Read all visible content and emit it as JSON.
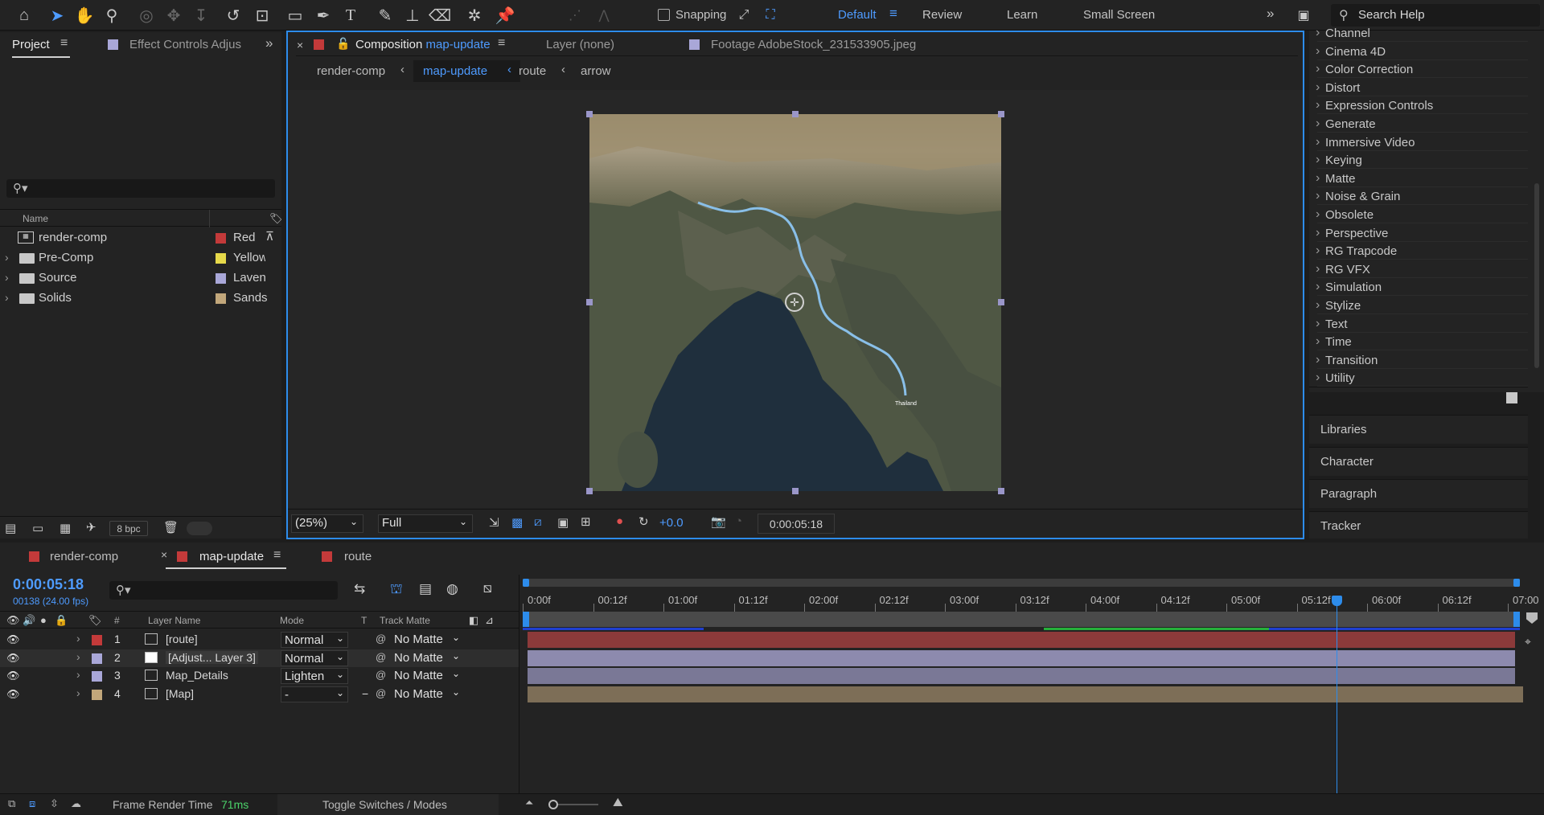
{
  "toolbar": {
    "snapping_label": "Snapping",
    "workspaces": [
      "Default",
      "Review",
      "Learn",
      "Small Screen"
    ],
    "active_workspace": "Default",
    "search_placeholder": "Search Help",
    "icons": [
      "home-icon",
      "selection-tool-icon",
      "hand-tool-icon",
      "zoom-tool-icon",
      "orbit-camera-icon",
      "pan-camera-icon",
      "dolly-camera-icon",
      "rotation-tool-icon",
      "pan-behind-icon",
      "rectangle-tool-icon",
      "pen-tool-icon",
      "type-tool-icon",
      "brush-tool-icon",
      "clone-stamp-icon",
      "eraser-tool-icon",
      "roto-brush-icon",
      "puppet-pin-icon"
    ]
  },
  "project_panel": {
    "tab_project": "Project",
    "tab_effect_controls": "Effect Controls Adjus",
    "column_name": "Name",
    "items": [
      {
        "name": "render-comp",
        "label": "Red",
        "label_color": "#c33a3a",
        "type": "composition"
      },
      {
        "name": "Pre-Comp",
        "label": "Yellow",
        "label_color": "#e6d94a",
        "type": "folder"
      },
      {
        "name": "Source",
        "label": "Laven",
        "label_color": "#a9a7d8",
        "type": "folder"
      },
      {
        "name": "Solids",
        "label": "Sands",
        "label_color": "#c2a77b",
        "type": "folder"
      }
    ],
    "bpc": "8 bpc"
  },
  "composition_panel": {
    "tab_prefix": "Composition",
    "tab_comp_name": "map-update",
    "tab_layer": "Layer (none)",
    "tab_footage": "Footage AdobeStock_231533905.jpeg",
    "breadcrumbs": [
      "render-comp",
      "map-update",
      "route",
      "arrow"
    ],
    "active_breadcrumb": "map-update",
    "zoom": "(25%)",
    "resolution": "Full",
    "exposure": "+0.0",
    "timecode": "0:00:05:18",
    "map_label": "Thailand"
  },
  "effects_panel": {
    "categories": [
      "Channel",
      "Cinema 4D",
      "Color Correction",
      "Distort",
      "Expression Controls",
      "Generate",
      "Immersive Video",
      "Keying",
      "Matte",
      "Noise & Grain",
      "Obsolete",
      "Perspective",
      "RG Trapcode",
      "RG VFX",
      "Simulation",
      "Stylize",
      "Text",
      "Time",
      "Transition",
      "Utility"
    ],
    "stacked_panels": [
      "Libraries",
      "Character",
      "Paragraph",
      "Tracker"
    ]
  },
  "timeline": {
    "tabs": [
      {
        "name": "render-comp",
        "color": "#c33a3a"
      },
      {
        "name": "map-update",
        "color": "#c33a3a",
        "active": true
      },
      {
        "name": "route",
        "color": "#c33a3a"
      }
    ],
    "current_time": "0:00:05:18",
    "frame_info": "00138 (24.00 fps)",
    "column_headers": {
      "hash": "#",
      "layer_name": "Layer Name",
      "mode": "Mode",
      "t": "T",
      "track_matte": "Track Matte"
    },
    "ruler_labels": [
      "0:00f",
      "00:12f",
      "01:00f",
      "01:12f",
      "02:00f",
      "02:12f",
      "03:00f",
      "03:12f",
      "04:00f",
      "04:12f",
      "05:00f",
      "05:12f",
      "06:00f",
      "06:12f",
      "07:00"
    ],
    "layers": [
      {
        "num": "1",
        "name": "[route]",
        "mode": "Normal",
        "t": "",
        "matte": "No Matte",
        "color": "#c33a3a",
        "bar_color": "#8c3a3a"
      },
      {
        "num": "2",
        "name": "[Adjust... Layer 3]",
        "mode": "Normal",
        "t": "",
        "matte": "No Matte",
        "color": "#a9a7d8",
        "bar_color": "#8d8aae"
      },
      {
        "num": "3",
        "name": "Map_Details",
        "mode": "Lighten",
        "t": "",
        "matte": "No Matte",
        "color": "#a9a7d8",
        "bar_color": "#7a7896"
      },
      {
        "num": "4",
        "name": "[Map]",
        "mode": "-",
        "t": "−",
        "matte": "No Matte",
        "color": "#c2a77b",
        "bar_color": "#7d6e57"
      }
    ]
  },
  "status_bar": {
    "frame_render_label": "Frame Render Time",
    "frame_render_value": "71ms",
    "toggle_label": "Toggle Switches / Modes"
  }
}
